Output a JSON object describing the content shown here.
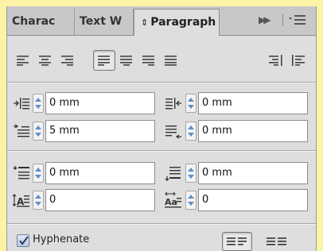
{
  "tabs": [
    {
      "label": "Charac",
      "active": false
    },
    {
      "label": "Text W",
      "active": false
    },
    {
      "label": "Paragraph",
      "active": true
    }
  ],
  "tab_sort_glyph": "⇕",
  "alignment": {
    "buttons": [
      "align-left",
      "align-center",
      "align-right",
      "justify-left",
      "justify-center",
      "justify-right",
      "justify-all",
      "align-towards-spine",
      "align-away-from-spine"
    ],
    "selected": "justify-left"
  },
  "indents": {
    "left_indent": "0 mm",
    "right_indent": "0 mm",
    "first_line_indent": "5 mm",
    "last_line_right_indent": "0 mm"
  },
  "spacing": {
    "space_before": "0 mm",
    "space_after": "0 mm",
    "drop_cap_lines": "0",
    "drop_cap_chars": "0"
  },
  "hyphenate": {
    "label": "Hyphenate",
    "checked": true
  },
  "colors": {
    "panel_bg": "#dedede",
    "page_bg": "#fcf3a6",
    "stepper_arrow": "#5b8fc8",
    "checkbox_blue": "#b9cbe6"
  }
}
